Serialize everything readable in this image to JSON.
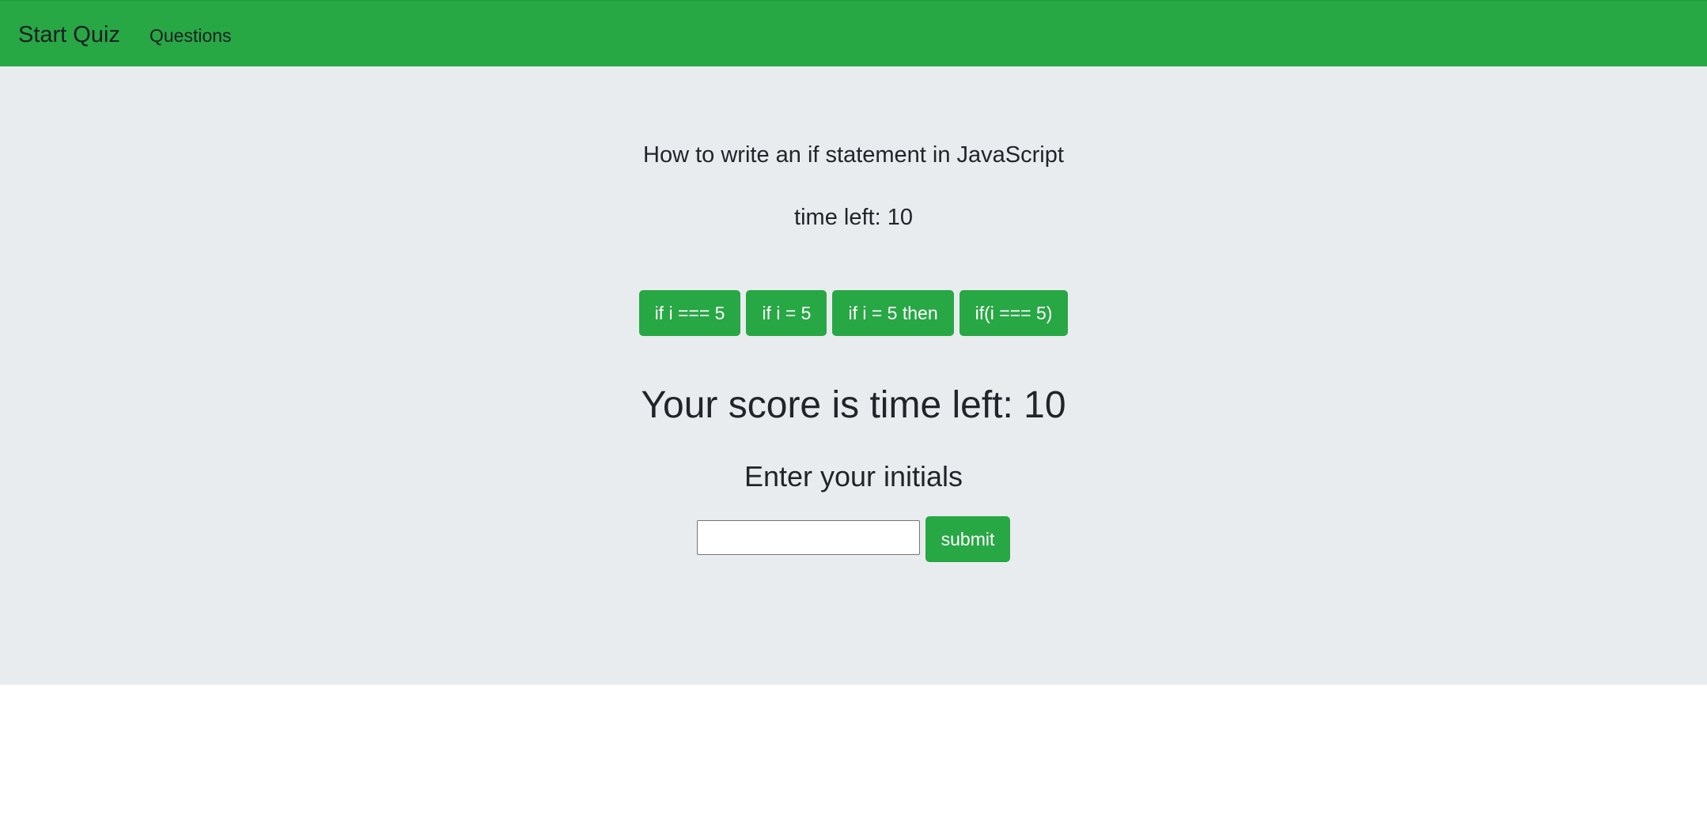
{
  "navbar": {
    "brand": "Start Quiz",
    "links": [
      "Questions"
    ],
    "color": "#28a745"
  },
  "quiz": {
    "question": "How to write an if statement in JavaScript",
    "timer_text": "time left: 10",
    "choices": [
      "if i === 5",
      "if i = 5",
      "if i = 5 then",
      "if(i === 5)"
    ]
  },
  "result": {
    "score_text": "Your score is time left: 10",
    "initials_heading": "Enter your initials",
    "initials_value": "",
    "submit_label": "submit"
  },
  "colors": {
    "accent": "#28a745",
    "panel_background": "#e9ecef",
    "text": "#212529"
  }
}
